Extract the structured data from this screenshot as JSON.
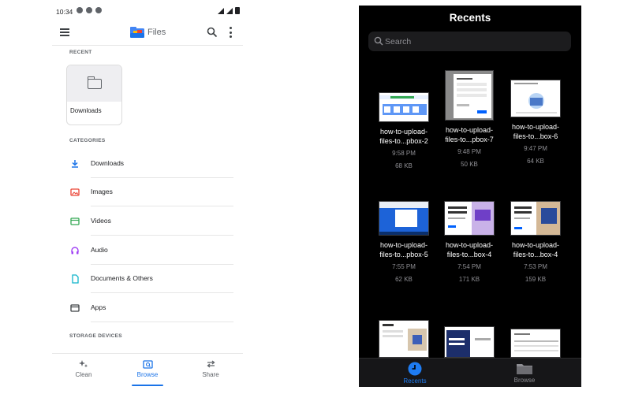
{
  "android": {
    "status_time": "10:34",
    "app_title": "Files",
    "recent_header": "RECENT",
    "recent_card_label": "Downloads",
    "categories_header": "CATEGORIES",
    "categories": [
      {
        "label": "Downloads",
        "icon": "download-icon",
        "color": "#1a73e8"
      },
      {
        "label": "Images",
        "icon": "image-icon",
        "color": "#ea4335"
      },
      {
        "label": "Videos",
        "icon": "video-icon",
        "color": "#34a853"
      },
      {
        "label": "Audio",
        "icon": "audio-icon",
        "color": "#a142f4"
      },
      {
        "label": "Documents & Others",
        "icon": "document-icon",
        "color": "#12b5cb"
      },
      {
        "label": "Apps",
        "icon": "apps-icon",
        "color": "#5f6368"
      }
    ],
    "storage_header": "STORAGE DEVICES",
    "tabs": [
      {
        "label": "Clean",
        "icon": "sparkle-icon"
      },
      {
        "label": "Browse",
        "icon": "browse-icon"
      },
      {
        "label": "Share",
        "icon": "share-icon"
      }
    ],
    "active_tab": "Browse",
    "accent_color": "#1a73e8"
  },
  "ios": {
    "title": "Recents",
    "search_placeholder": "Search",
    "files": [
      {
        "name_line1": "how-to-upload-",
        "name_line2": "files-to...pbox-2",
        "time": "9:58 PM",
        "size": "68 KB"
      },
      {
        "name_line1": "how-to-upload-",
        "name_line2": "files-to...pbox-7",
        "time": "9:48 PM",
        "size": "50 KB"
      },
      {
        "name_line1": "how-to-upload-",
        "name_line2": "files-to...box-6",
        "time": "9:47 PM",
        "size": "64 KB"
      },
      {
        "name_line1": "how-to-upload-",
        "name_line2": "files-to...pbox-5",
        "time": "7:55 PM",
        "size": "62 KB"
      },
      {
        "name_line1": "how-to-upload-",
        "name_line2": "files-to...box-4",
        "time": "7:54 PM",
        "size": "171 KB"
      },
      {
        "name_line1": "how-to-upload-",
        "name_line2": "files-to...box-4",
        "time": "7:53 PM",
        "size": "159 KB"
      },
      {
        "name_line1": "",
        "name_line2": "",
        "time": "",
        "size": ""
      },
      {
        "name_line1": "",
        "name_line2": "",
        "time": "",
        "size": ""
      },
      {
        "name_line1": "",
        "name_line2": "",
        "time": "",
        "size": ""
      }
    ],
    "tabs": [
      {
        "label": "Recents",
        "icon": "clock-icon"
      },
      {
        "label": "Browse",
        "icon": "folder-icon"
      }
    ],
    "active_tab": "Recents",
    "accent_color": "#1e7cf2"
  }
}
